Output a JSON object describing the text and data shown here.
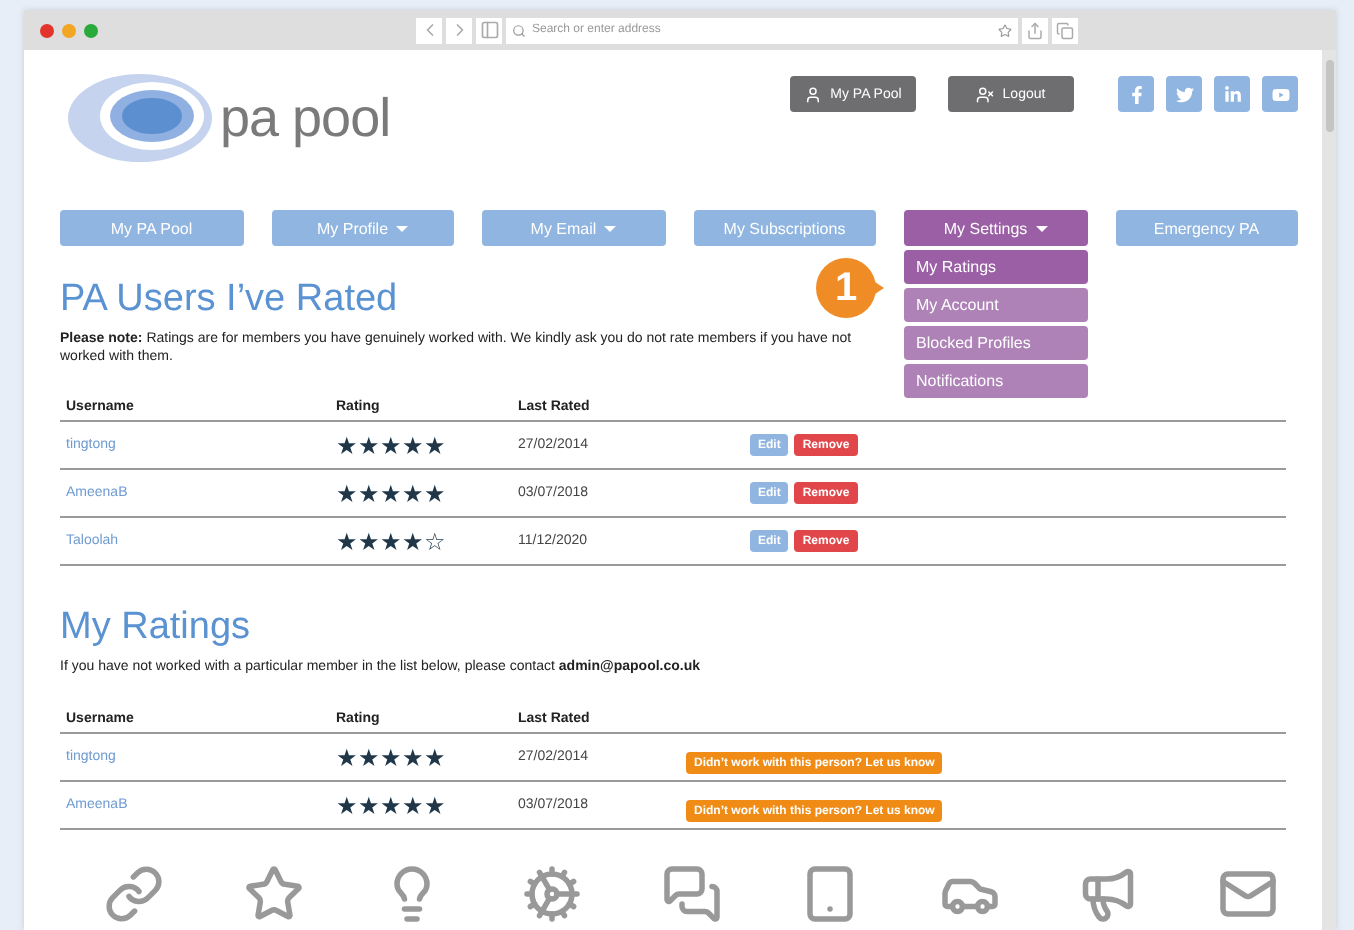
{
  "browser": {
    "address_placeholder": "Search or enter address"
  },
  "logo": {
    "text": "pa pool"
  },
  "header_buttons": [
    {
      "label": "My PA Pool",
      "kind": "user"
    },
    {
      "label": "Logout",
      "kind": "logout"
    }
  ],
  "social": [
    {
      "kind": "facebook"
    },
    {
      "kind": "twitter"
    },
    {
      "kind": "linkedin"
    },
    {
      "kind": "youtube"
    }
  ],
  "nav": [
    {
      "label": "My PA Pool",
      "selected": false,
      "caret": false
    },
    {
      "label": "My Profile",
      "selected": false,
      "caret": true
    },
    {
      "label": "My Email",
      "selected": false,
      "caret": true
    },
    {
      "label": "My Subscriptions",
      "selected": false,
      "caret": false
    },
    {
      "label": "My Settings",
      "selected": true,
      "caret": true
    },
    {
      "label": "Emergency PA",
      "selected": false,
      "caret": false
    }
  ],
  "dropdown": [
    {
      "label": "My Ratings",
      "selected": true
    },
    {
      "label": "My Account",
      "selected": false
    },
    {
      "label": "Blocked Profiles",
      "selected": false
    },
    {
      "label": "Notifications",
      "selected": false
    }
  ],
  "step_badge": "1",
  "rated": {
    "title": "PA Users I’ve Rated",
    "note": "**Please note:** Ratings are for members you have genuinely worked with. We kindly ask you do not rate members if you have not worked with them.",
    "columns": [
      "Username",
      "Rating",
      "Last Rated"
    ],
    "rows": [
      {
        "username": "tingtong",
        "stars": 5,
        "date": "27/02/2014",
        "actions": [
          "Edit",
          "Remove"
        ]
      },
      {
        "username": "AmeenaB",
        "stars": 5,
        "date": "03/07/2018",
        "actions": [
          "Edit",
          "Remove"
        ]
      },
      {
        "username": "Taloolah",
        "stars": 4,
        "date": "11/12/2020",
        "actions": [
          "Edit",
          "Remove"
        ]
      }
    ]
  },
  "my_ratings": {
    "title": "My Ratings",
    "note": "If you have not worked with a particular member in the list below, please contact **admin@papool.co.uk**",
    "columns": [
      "Username",
      "Rating",
      "Last Rated"
    ],
    "rows": [
      {
        "username": "tingtong",
        "stars": 5,
        "date": "27/02/2014",
        "action": "Didn’t work with this person? Let us know"
      },
      {
        "username": "AmeenaB",
        "stars": 5,
        "date": "03/07/2018",
        "action": "Didn’t work with this person? Let us know"
      }
    ]
  },
  "footer_icons": [
    {
      "kind": "link"
    },
    {
      "kind": "star"
    },
    {
      "kind": "bulb"
    },
    {
      "kind": "cogs"
    },
    {
      "kind": "chat"
    },
    {
      "kind": "tablet"
    },
    {
      "kind": "car"
    },
    {
      "kind": "megaphone"
    },
    {
      "kind": "mail"
    }
  ]
}
